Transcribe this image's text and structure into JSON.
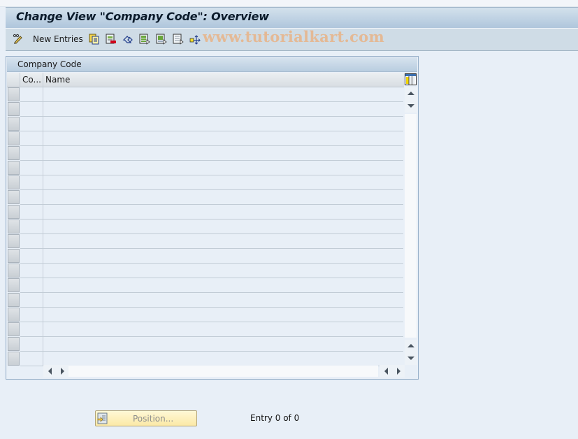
{
  "window": {
    "title": "Change View \"Company Code\": Overview"
  },
  "toolbar": {
    "items": [
      {
        "icon": "pencil-glasses-icon",
        "label": ""
      },
      {
        "icon": "",
        "label": "New Entries"
      },
      {
        "icon": "copy-as-icon",
        "label": ""
      },
      {
        "icon": "delete-icon",
        "label": ""
      },
      {
        "icon": "undo-change-icon",
        "label": ""
      },
      {
        "icon": "select-all-icon",
        "label": ""
      },
      {
        "icon": "select-block-icon",
        "label": ""
      },
      {
        "icon": "deselect-all-icon",
        "label": ""
      },
      {
        "icon": "navigation-icon",
        "label": ""
      }
    ],
    "watermark": "www.tutorialkart.com"
  },
  "table": {
    "caption": "Company Code",
    "columns": [
      {
        "key": "code",
        "header": "Co..."
      },
      {
        "key": "name",
        "header": "Name"
      }
    ],
    "rows": [],
    "visible_empty_rows": 19,
    "layout_icon": "table-settings-icon"
  },
  "footer": {
    "position_button": "Position...",
    "entry_text": "Entry 0 of 0"
  },
  "colors": {
    "background": "#e8eff7",
    "title_gradient_top": "#d3e1ec",
    "title_gradient_bottom": "#afc6dc",
    "toolbar_bg": "#cfdce6",
    "button_yellow": "#fbe9a6",
    "watermark": "#e8b488"
  }
}
